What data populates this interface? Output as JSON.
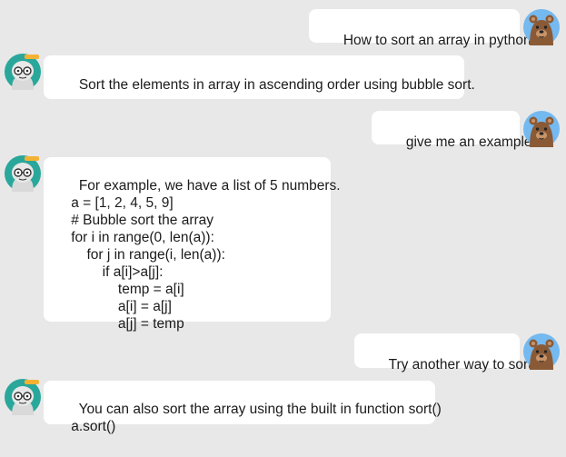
{
  "conversation": {
    "messages": [
      {
        "role": "user",
        "text": "How to sort an array in python",
        "avatar_icon": "bear-avatar-icon"
      },
      {
        "role": "bot",
        "text": "Sort the elements in array in ascending order using bubble sort.",
        "avatar_icon": "robot-avatar-icon"
      },
      {
        "role": "user",
        "text": "give me an example",
        "avatar_icon": "bear-avatar-icon"
      },
      {
        "role": "bot",
        "text": "For example, we have a list of 5 numbers.\n    a = [1, 2, 4, 5, 9]\n    # Bubble sort the array\n    for i in range(0, len(a)):\n        for j in range(i, len(a)):\n            if a[i]>a[j]:\n                temp = a[i]\n                a[i] = a[j]\n                a[j] = temp",
        "avatar_icon": "robot-avatar-icon"
      },
      {
        "role": "user",
        "text": "Try another way to sort",
        "avatar_icon": "bear-avatar-icon"
      },
      {
        "role": "bot",
        "text": "You can also sort the array using the built in function sort()\n    a.sort()",
        "avatar_icon": "robot-avatar-icon"
      }
    ]
  },
  "colors": {
    "background": "#e8e8e8",
    "bubble": "#ffffff",
    "user_avatar_bg": "#74b9f0",
    "bot_avatar_bg": "#2aa79b"
  }
}
